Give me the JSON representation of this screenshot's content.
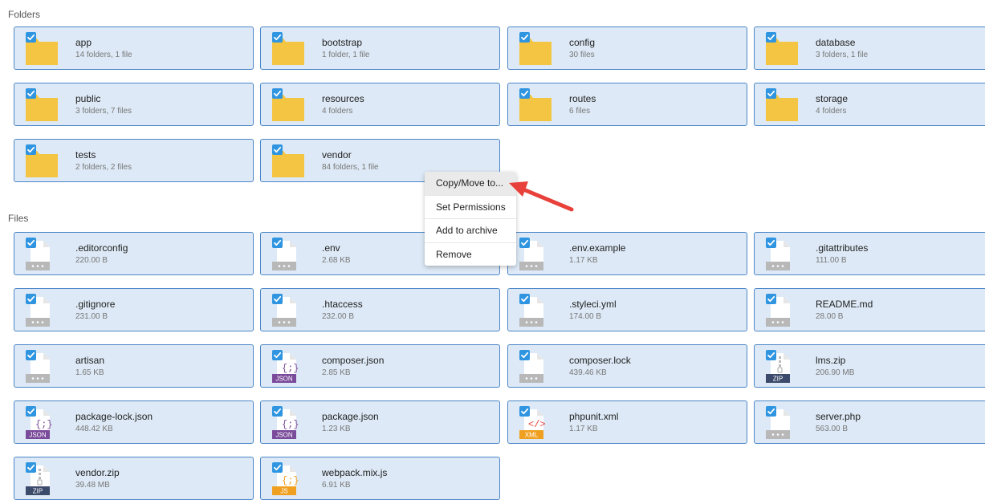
{
  "sections": {
    "folders_title": "Folders",
    "files_title": "Files"
  },
  "folders": [
    {
      "name": "app",
      "meta": "14 folders, 1 file"
    },
    {
      "name": "bootstrap",
      "meta": "1 folder, 1 file"
    },
    {
      "name": "config",
      "meta": "30 files"
    },
    {
      "name": "database",
      "meta": "3 folders, 1 file"
    },
    {
      "name": "public",
      "meta": "3 folders, 7 files"
    },
    {
      "name": "resources",
      "meta": "4 folders"
    },
    {
      "name": "routes",
      "meta": "6 files"
    },
    {
      "name": "storage",
      "meta": "4 folders"
    },
    {
      "name": "tests",
      "meta": "2 folders, 2 files"
    },
    {
      "name": "vendor",
      "meta": "84 folders, 1 file"
    }
  ],
  "files": [
    {
      "name": ".editorconfig",
      "meta": "220.00 B",
      "icon": "generic"
    },
    {
      "name": ".env",
      "meta": "2.68 KB",
      "icon": "generic"
    },
    {
      "name": ".env.example",
      "meta": "1.17 KB",
      "icon": "generic"
    },
    {
      "name": ".gitattributes",
      "meta": "111.00 B",
      "icon": "generic"
    },
    {
      "name": ".gitignore",
      "meta": "231.00 B",
      "icon": "generic"
    },
    {
      "name": ".htaccess",
      "meta": "232.00 B",
      "icon": "generic"
    },
    {
      "name": ".styleci.yml",
      "meta": "174.00 B",
      "icon": "generic"
    },
    {
      "name": "README.md",
      "meta": "28.00 B",
      "icon": "generic"
    },
    {
      "name": "artisan",
      "meta": "1.65 KB",
      "icon": "generic"
    },
    {
      "name": "composer.json",
      "meta": "2.85 KB",
      "icon": "json",
      "badge": "JSON"
    },
    {
      "name": "composer.lock",
      "meta": "439.46 KB",
      "icon": "generic"
    },
    {
      "name": "lms.zip",
      "meta": "206.90 MB",
      "icon": "zip",
      "badge": "ZIP"
    },
    {
      "name": "package-lock.json",
      "meta": "448.42 KB",
      "icon": "json",
      "badge": "JSON"
    },
    {
      "name": "package.json",
      "meta": "1.23 KB",
      "icon": "json",
      "badge": "JSON"
    },
    {
      "name": "phpunit.xml",
      "meta": "1.17 KB",
      "icon": "xml",
      "badge": "XML"
    },
    {
      "name": "server.php",
      "meta": "563.00 B",
      "icon": "generic"
    },
    {
      "name": "vendor.zip",
      "meta": "39.48 MB",
      "icon": "zip",
      "badge": "ZIP"
    },
    {
      "name": "webpack.mix.js",
      "meta": "6.91 KB",
      "icon": "js",
      "badge": "JS"
    }
  ],
  "context_menu": {
    "items": [
      "Copy/Move to...",
      "Set Permissions",
      "Add to archive",
      "Remove"
    ]
  },
  "colors": {
    "tile_bg": "#dde9f6",
    "tile_border": "#4b86c8",
    "checkbox": "#2f95e0",
    "folder": "#f4c542",
    "json_badge": "#7a4b9a",
    "zip_badge": "#3c4a6b",
    "xml_badge": "#f0a020",
    "js_badge": "#f0a020",
    "generic_badge": "#b8b8b8",
    "arrow": "#e8403a"
  }
}
